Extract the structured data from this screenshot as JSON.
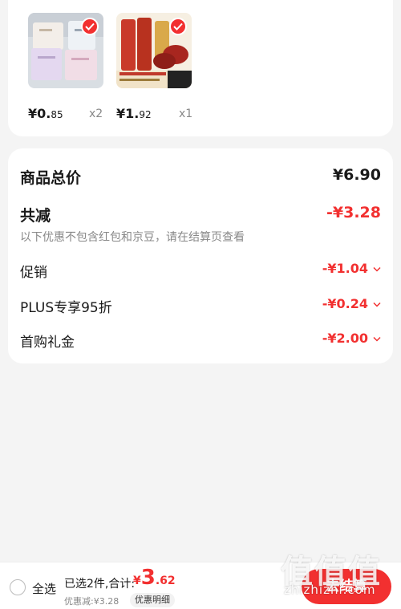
{
  "colors": {
    "accent": "#f23030",
    "muted": "#888888",
    "background": "#f4f4f4"
  },
  "products": [
    {
      "image": "towel-packs-image",
      "price_int": "¥0.",
      "price_dec": "85",
      "qty": "x2",
      "checked": true
    },
    {
      "image": "sausage-packs-image",
      "price_int": "¥1.",
      "price_dec": "92",
      "qty": "x1",
      "checked": true
    }
  ],
  "summary": {
    "total_label": "商品总价",
    "total_value": "¥6.90",
    "reduce_label": "共减",
    "reduce_value": "-¥3.28",
    "note": "以下优惠不包含红包和京豆，请在结算页查看",
    "items": [
      {
        "label": "促销",
        "value": "-¥1.04"
      },
      {
        "label": "PLUS专享95折",
        "value": "-¥0.24"
      },
      {
        "label": "首购礼金",
        "value": "-¥2.00"
      }
    ],
    "chevron_icon": "chevron-down-icon"
  },
  "bottom": {
    "select_all": "全选",
    "selected_info": "已选2件,合计:",
    "total_currency": "¥",
    "total_int": "3",
    "total_dec": ".62",
    "discount_info": "优惠减:¥3.28",
    "detail_button": "优惠明细",
    "checkout_button": "去结算"
  },
  "watermark": {
    "chars": "值值值",
    "url": "zhizhizhi.com"
  }
}
